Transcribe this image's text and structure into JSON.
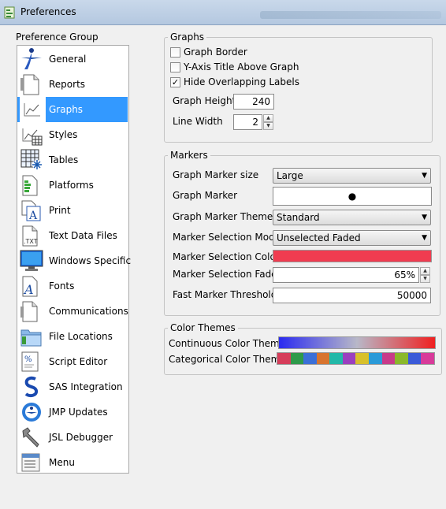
{
  "window": {
    "title": "Preferences"
  },
  "nav": {
    "group_label": "Preference Group",
    "items": [
      {
        "label": "General",
        "icon": "general-icon"
      },
      {
        "label": "Reports",
        "icon": "reports-icon"
      },
      {
        "label": "Graphs",
        "icon": "graphs-icon",
        "selected": true
      },
      {
        "label": "Styles",
        "icon": "styles-icon"
      },
      {
        "label": "Tables",
        "icon": "tables-icon"
      },
      {
        "label": "Platforms",
        "icon": "platforms-icon"
      },
      {
        "label": "Print",
        "icon": "print-icon"
      },
      {
        "label": "Text Data Files",
        "icon": "text-data-files-icon"
      },
      {
        "label": "Windows Specific",
        "icon": "windows-specific-icon"
      },
      {
        "label": "Fonts",
        "icon": "fonts-icon"
      },
      {
        "label": "Communications",
        "icon": "communications-icon"
      },
      {
        "label": "File Locations",
        "icon": "file-locations-icon"
      },
      {
        "label": "Script Editor",
        "icon": "script-editor-icon"
      },
      {
        "label": "SAS Integration",
        "icon": "sas-integration-icon"
      },
      {
        "label": "JMP Updates",
        "icon": "jmp-updates-icon"
      },
      {
        "label": "JSL Debugger",
        "icon": "jsl-debugger-icon"
      },
      {
        "label": "Menu",
        "icon": "menu-icon"
      }
    ]
  },
  "graphs": {
    "legend": "Graphs",
    "graph_border": {
      "label": "Graph Border",
      "checked": false
    },
    "y_axis_title": {
      "label": "Y-Axis Title Above Graph",
      "checked": false
    },
    "hide_overlapping": {
      "label": "Hide Overlapping Labels",
      "checked": true,
      "mark": "✓"
    },
    "graph_height": {
      "label": "Graph Height",
      "value": "240"
    },
    "line_width": {
      "label": "Line Width",
      "value": "2"
    }
  },
  "markers": {
    "legend": "Markers",
    "marker_size": {
      "label": "Graph Marker size",
      "value": "Large"
    },
    "marker": {
      "label": "Graph Marker",
      "symbol": "●"
    },
    "marker_theme": {
      "label": "Graph Marker Theme",
      "value": "Standard"
    },
    "selection_mode": {
      "label": "Marker Selection Mode",
      "value": "Unselected Faded"
    },
    "selection_color": {
      "label": "Marker Selection Color",
      "color": "#f03c50"
    },
    "selection_fade": {
      "label": "Marker Selection Fade",
      "value": "65%"
    },
    "fast_threshold": {
      "label": "Fast Marker Threshold",
      "value": "50000"
    }
  },
  "color_themes": {
    "legend": "Color Themes",
    "continuous": {
      "label": "Continuous Color Theme",
      "colors": [
        "#2a2af0",
        "#b8b8c8",
        "#f02020"
      ]
    },
    "categorical": {
      "label": "Categorical Color Theme",
      "colors": [
        "#d63d5a",
        "#2e9a4a",
        "#3b6fd8",
        "#d8742e",
        "#22b8a8",
        "#9b3fbf",
        "#d8c02a",
        "#2a9ad8",
        "#c83a8a",
        "#8ab82a",
        "#3a5ad8",
        "#d83a9a"
      ]
    }
  },
  "colors": {
    "accent": "#3399ff"
  }
}
